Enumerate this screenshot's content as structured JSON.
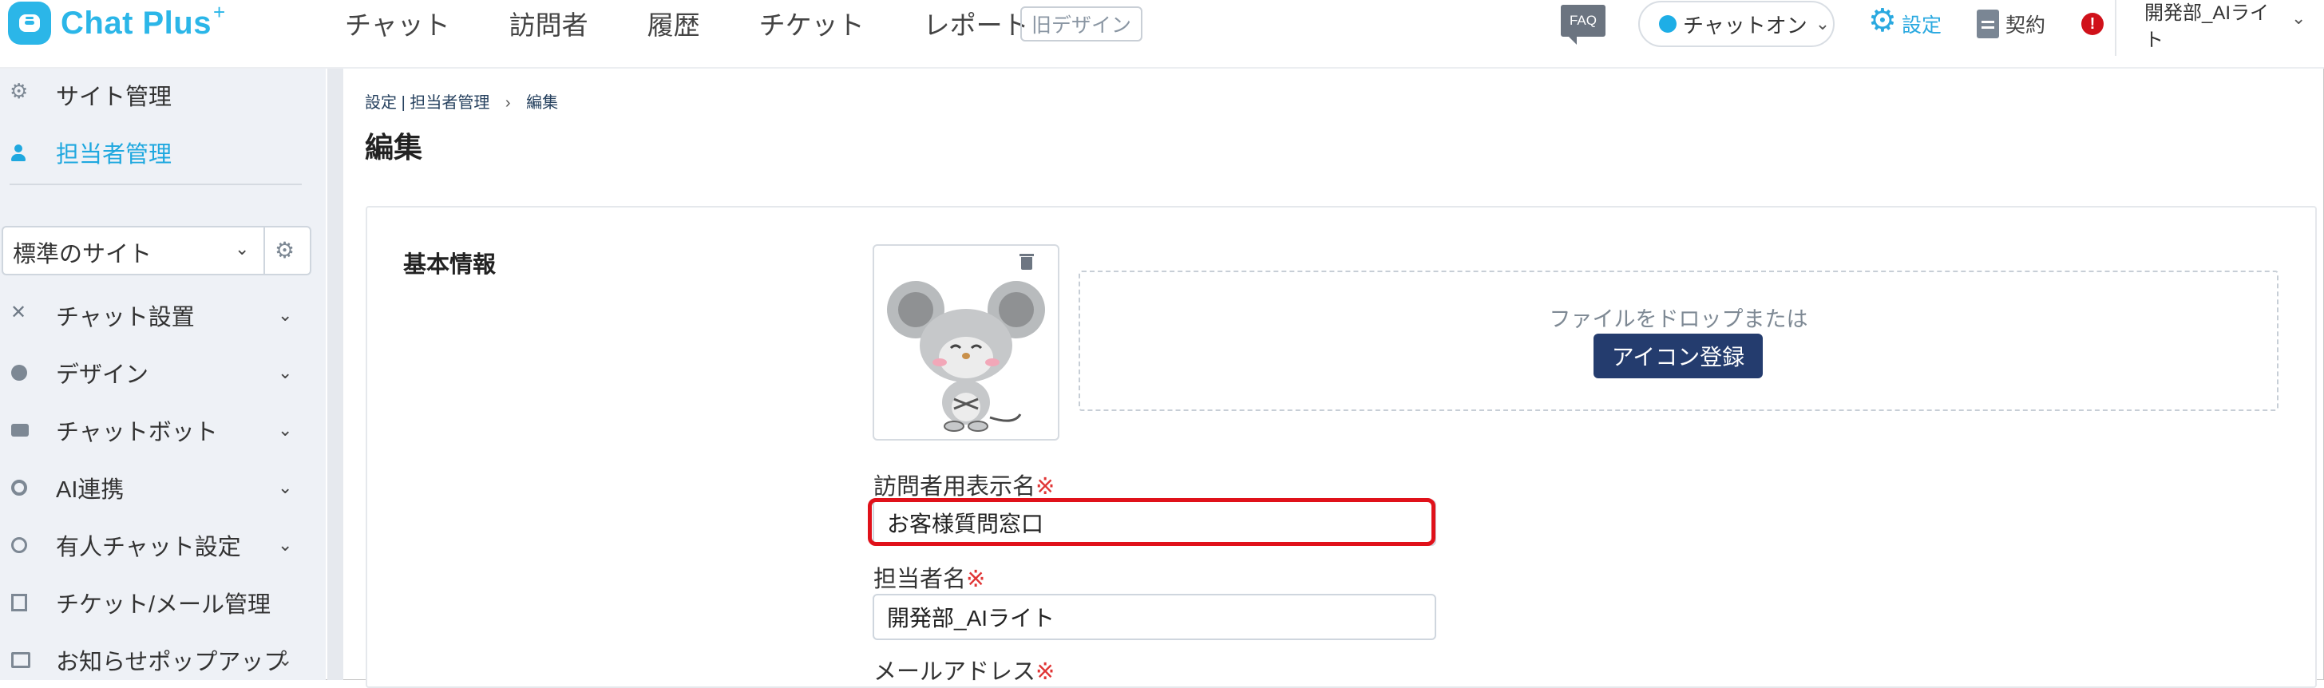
{
  "header": {
    "logo_text": "Chat Plus",
    "logo_plus": "+",
    "nav": [
      "チャット",
      "訪問者",
      "履歴",
      "チケット",
      "レポート"
    ],
    "old_design": "旧デザイン",
    "faq": "FAQ",
    "status": "チャットオン",
    "settings": "設定",
    "contract": "契約",
    "alert": "!",
    "user": "開発部_AIライト"
  },
  "sidebar": {
    "top_items": [
      {
        "label": "サイト管理",
        "icon": "gear-icon"
      },
      {
        "label": "担当者管理",
        "icon": "user-icon",
        "active": true
      }
    ],
    "site_select": "標準のサイト",
    "menu": [
      {
        "label": "チャット設置",
        "icon": "tools-icon"
      },
      {
        "label": "デザイン",
        "icon": "palette-icon"
      },
      {
        "label": "チャットボット",
        "icon": "chat-icon"
      },
      {
        "label": "AI連携",
        "icon": "ai-icon"
      },
      {
        "label": "有人チャット設定",
        "icon": "headset-icon"
      },
      {
        "label": "チケット/メール管理",
        "icon": "list-icon"
      },
      {
        "label": "お知らせポップアップ",
        "icon": "popup-icon"
      }
    ]
  },
  "main": {
    "breadcrumb": {
      "crumb1": "設定",
      "sep": "|",
      "crumb2": "担当者管理",
      "arrow": "›",
      "crumb3": "編集"
    },
    "title": "編集",
    "section_title": "基本情報",
    "dropzone_text": "ファイルをドロップまたは",
    "icon_button": "アイコン登録",
    "required_mark": "※",
    "fields": [
      {
        "label": "訪問者用表示名",
        "value": "お客様質問窓口"
      },
      {
        "label": "担当者名",
        "value": "開発部_AIライト"
      },
      {
        "label": "メールアドレス",
        "value": ""
      }
    ]
  },
  "colors": {
    "accent": "#2bb6e8",
    "button": "#243c6e",
    "highlight": "#e0111a",
    "required": "#e03535"
  }
}
